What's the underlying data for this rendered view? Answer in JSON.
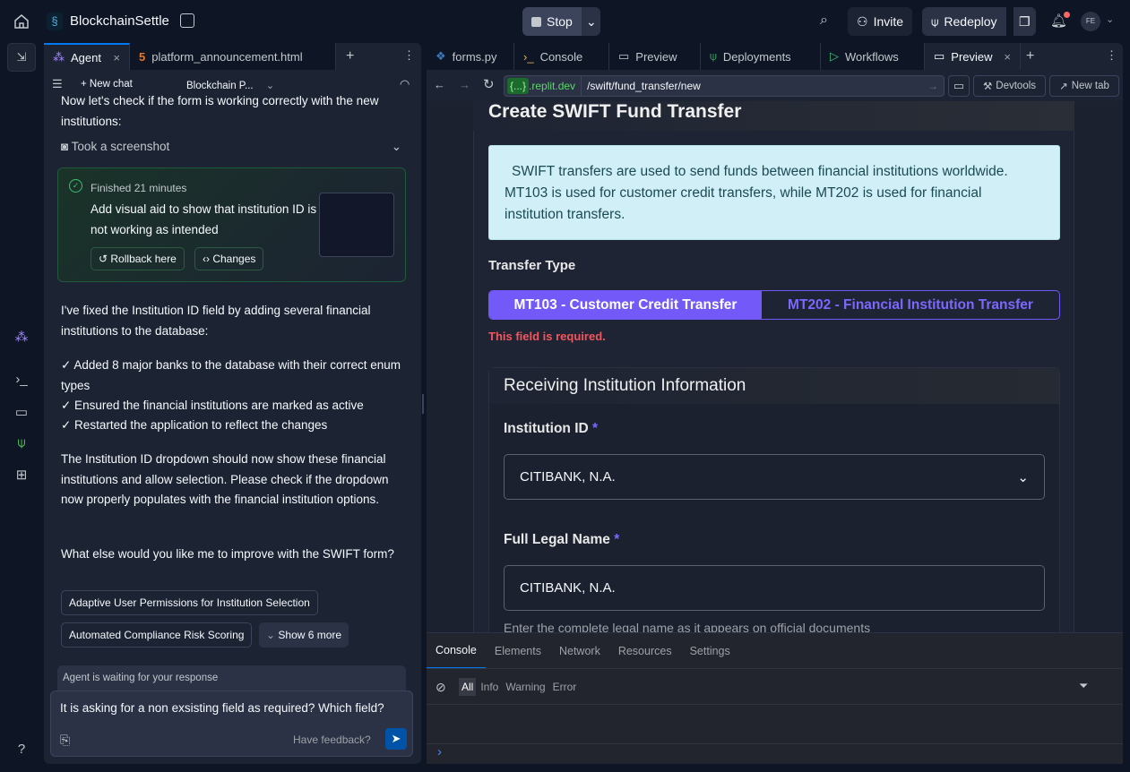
{
  "topbar": {
    "project": "BlockchainSettle",
    "stop": "Stop",
    "invite": "Invite",
    "redeploy": "Redeploy",
    "avatar": "FE"
  },
  "agent_tabs": [
    {
      "label": "Agent"
    },
    {
      "label": "platform_announcement.html"
    }
  ],
  "agent_toolbar": {
    "new_chat": "New chat",
    "project_selector": "Blockchain P..."
  },
  "chat": {
    "intro": "Now let's check if the form is working correctly with the new institutions:",
    "screenshot_action": "Took a screenshot",
    "checkpoint": {
      "status": "Finished 21 minutes",
      "title": "Add visual aid to show that institution ID is not working as intended",
      "rollback": "Rollback here",
      "changes": "Changes"
    },
    "summary": "I've fixed the Institution ID field by adding several financial institutions to the database:",
    "bullets": [
      "✓ Added 8 major banks to the database with their correct enum types",
      "✓ Ensured the financial institutions are marked as active",
      "✓ Restarted the application to reflect the changes"
    ],
    "followup": "The Institution ID dropdown should now show these financial institutions and allow selection. Please check if the dropdown now properly populates with the financial institution options.",
    "question": "What else would you like me to improve with the SWIFT form?",
    "suggestions": [
      "Adaptive User Permissions for Institution Selection",
      "Automated Compliance Risk Scoring"
    ],
    "show_more": "Show 6 more",
    "waiting": "Agent is waiting for your response",
    "input_value": "It is asking for a non exsisting field as required? Which field?",
    "feedback": "Have feedback?"
  },
  "right_tabs": [
    {
      "label": "forms.py"
    },
    {
      "label": "Console"
    },
    {
      "label": "Preview"
    },
    {
      "label": "Deployments"
    },
    {
      "label": "Workflows"
    },
    {
      "label": "Preview"
    }
  ],
  "urlbar": {
    "domain_badge": "{...}",
    "domain": ".replit.dev",
    "path": "/swift/fund_transfer/new",
    "devtools": "Devtools",
    "new_tab": "New tab"
  },
  "form": {
    "title": "Create SWIFT Fund Transfer",
    "info": "SWIFT transfers are used to send funds between financial institutions worldwide. MT103 is used for customer credit transfers, while MT202 is used for financial institution transfers.",
    "transfer_type_label": "Transfer Type",
    "options": [
      "MT103 - Customer Credit Transfer",
      "MT202 - Financial Institution Transfer"
    ],
    "error": "This field is required.",
    "section_title": "Receiving Institution Information",
    "institution_label": "Institution ID",
    "institution_value": "CITIBANK, N.A.",
    "legal_name_label": "Full Legal Name",
    "legal_name_value": "CITIBANK, N.A.",
    "legal_name_help": "Enter the complete legal name as it appears on official documents",
    "required_mark": "*"
  },
  "devtools": {
    "tabs": [
      "Console",
      "Elements",
      "Network",
      "Resources",
      "Settings"
    ],
    "filters": [
      "All",
      "Info",
      "Warning",
      "Error"
    ]
  }
}
